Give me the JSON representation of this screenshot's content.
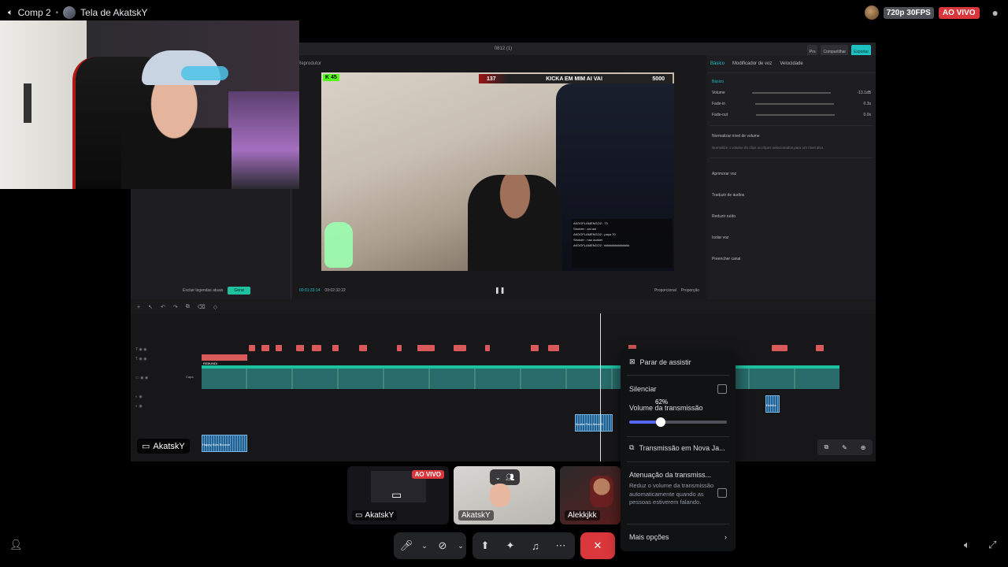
{
  "topbar": {
    "channel": "Comp 2",
    "separator": "•",
    "screen_title": "Tela de AkatskY",
    "quality": "720p 30FPS",
    "live": "AO VIVO"
  },
  "editor": {
    "window_title": "0812 (1)",
    "btn_pro": "Pro",
    "btn_share": "Compartilhar",
    "btn_export": "Exportar",
    "player_label": "Reprodutor",
    "timecode_current": "00:01:33:14",
    "timecode_total": "00:02:32:22",
    "player_btn_a": "Proporcional",
    "player_btn_b": "Proporção",
    "left_option": "Excluir legendas atuais",
    "left_button": "Gerar",
    "tabs": [
      "Básico",
      "Modificador de voz",
      "Velocidade"
    ],
    "section_basic": "Básico",
    "volume_label": "Volume",
    "volume_value": "-13.1dB",
    "fadein_label": "Fade-in",
    "fadein_value": "0.3s",
    "fadeout_label": "Fade-out",
    "fadeout_value": "0.0s",
    "normalize_label": "Normalizar nível de volume",
    "normalize_desc": "Normalize o volume do clipe ou clipes selecionados para um nível alvo.",
    "options": [
      "Aprimorar voz",
      "Traduzir de áudios",
      "Reduzir ruído",
      "Isolar voz",
      "Preencher canal"
    ],
    "clip_label": "Capa",
    "audio_clip_1": "Acaba Pelo Amor D",
    "audio_clip_2": "Happy Kids Bounce",
    "audio_clip_3": "Estrela",
    "clip_red_label": "REBUNDI"
  },
  "video": {
    "kick_badge": "K 45",
    "banner_left": "137",
    "banner_title": "KICKA EM MIM AI VAI",
    "banner_right": "5000",
    "chat_lines": [
      "AKDOFLAMENGO2 : 70",
      "Stroider : aoi aoi",
      "AKDOFLAMENGO2 : paça 70",
      "Stroider : nao acabei",
      "AKDOFLAMENGO2 : kkkkkkkkkkkkkkkk"
    ]
  },
  "share_label": "AkatskY",
  "tiles": [
    {
      "name": "AkatskY",
      "badge": "AO VIVO"
    },
    {
      "name": "AkatskY"
    },
    {
      "name": "Alekkjkk"
    }
  ],
  "menu": {
    "stop_watching": "Parar de assistir",
    "mute": "Silenciar",
    "volume_label": "Volume da transmissão",
    "volume_tooltip": "62%",
    "volume_level": 0.32,
    "popout": "Transmissão em Nova Ja...",
    "attenuation": "Atenuação da transmiss...",
    "attenuation_desc": "Reduz o volume da transmissão automaticamente quando as pessoas estiverem falando.",
    "more": "Mais opções"
  },
  "colors": {
    "accent": "#5865f2",
    "live": "#da373c",
    "teal": "#1ec1c1"
  }
}
